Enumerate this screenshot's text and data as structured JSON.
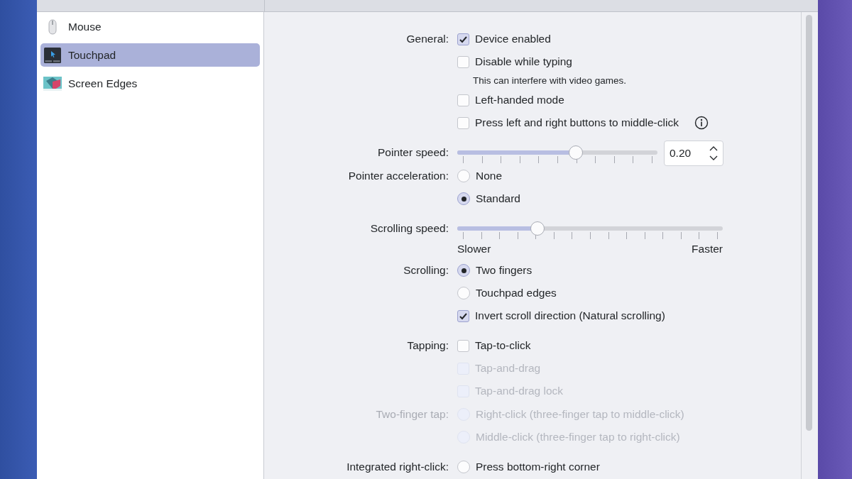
{
  "sidebar": {
    "items": [
      {
        "label": "Mouse",
        "kind": "mouse",
        "selected": false
      },
      {
        "label": "Touchpad",
        "kind": "touchpad",
        "selected": true
      },
      {
        "label": "Screen Edges",
        "kind": "edges",
        "selected": false
      }
    ]
  },
  "groups": [
    {
      "sections": [
        {
          "label": "General:",
          "disabled": false,
          "items": [
            {
              "kind": "checkbox",
              "label": "Device enabled",
              "checked": true,
              "disabled": false
            },
            {
              "kind": "checkbox",
              "label": "Disable while typing",
              "checked": false,
              "disabled": false
            },
            {
              "kind": "hint",
              "label": "This can interfere with video games."
            },
            {
              "kind": "checkbox",
              "label": "Left-handed mode",
              "checked": false,
              "disabled": false
            },
            {
              "kind": "checkbox",
              "label": "Press left and right buttons to middle-click",
              "checked": false,
              "disabled": false,
              "info_button": true
            }
          ]
        }
      ]
    },
    {
      "sections": [
        {
          "label": "Pointer speed:",
          "disabled": false,
          "items": [
            {
              "kind": "slider",
              "level": 0.6,
              "value": "0.20"
            }
          ]
        },
        {
          "label": "Pointer acceleration:",
          "disabled": false,
          "items": [
            {
              "kind": "radio",
              "label": "None",
              "selected": false,
              "disabled": false
            },
            {
              "kind": "radio",
              "label": "Standard",
              "selected": true,
              "disabled": false
            }
          ]
        }
      ]
    },
    {
      "sections": [
        {
          "label": "Scrolling speed:",
          "disabled": false,
          "items": [
            {
              "kind": "slider",
              "level": 0.29
            },
            {
              "kind": "scale",
              "left": "Slower",
              "right": "Faster"
            }
          ]
        },
        {
          "label": "Scrolling:",
          "disabled": false,
          "items": [
            {
              "kind": "radio",
              "label": "Two fingers",
              "selected": true,
              "disabled": false
            },
            {
              "kind": "radio",
              "label": "Touchpad edges",
              "selected": false,
              "disabled": false
            },
            {
              "kind": "checkbox",
              "label": "Invert scroll direction (Natural scrolling)",
              "checked": true,
              "disabled": false
            }
          ]
        }
      ]
    },
    {
      "sections": [
        {
          "label": "Tapping:",
          "disabled": false,
          "items": [
            {
              "kind": "checkbox",
              "label": "Tap-to-click",
              "checked": false,
              "disabled": false
            },
            {
              "kind": "checkbox",
              "label": "Tap-and-drag",
              "checked": false,
              "disabled": true
            },
            {
              "kind": "checkbox",
              "label": "Tap-and-drag lock",
              "checked": false,
              "disabled": true
            }
          ]
        },
        {
          "label": "Two-finger tap:",
          "disabled": true,
          "items": [
            {
              "kind": "radio",
              "label": "Right-click (three-finger tap to middle-click)",
              "selected": false,
              "disabled": true
            },
            {
              "kind": "radio",
              "label": "Middle-click (three-finger tap to right-click)",
              "selected": false,
              "disabled": true
            }
          ]
        }
      ]
    },
    {
      "sections": [
        {
          "label": "Integrated right-click:",
          "disabled": false,
          "items": [
            {
              "kind": "radio",
              "label": "Press bottom-right corner",
              "selected": false,
              "disabled": false
            }
          ]
        }
      ]
    }
  ]
}
